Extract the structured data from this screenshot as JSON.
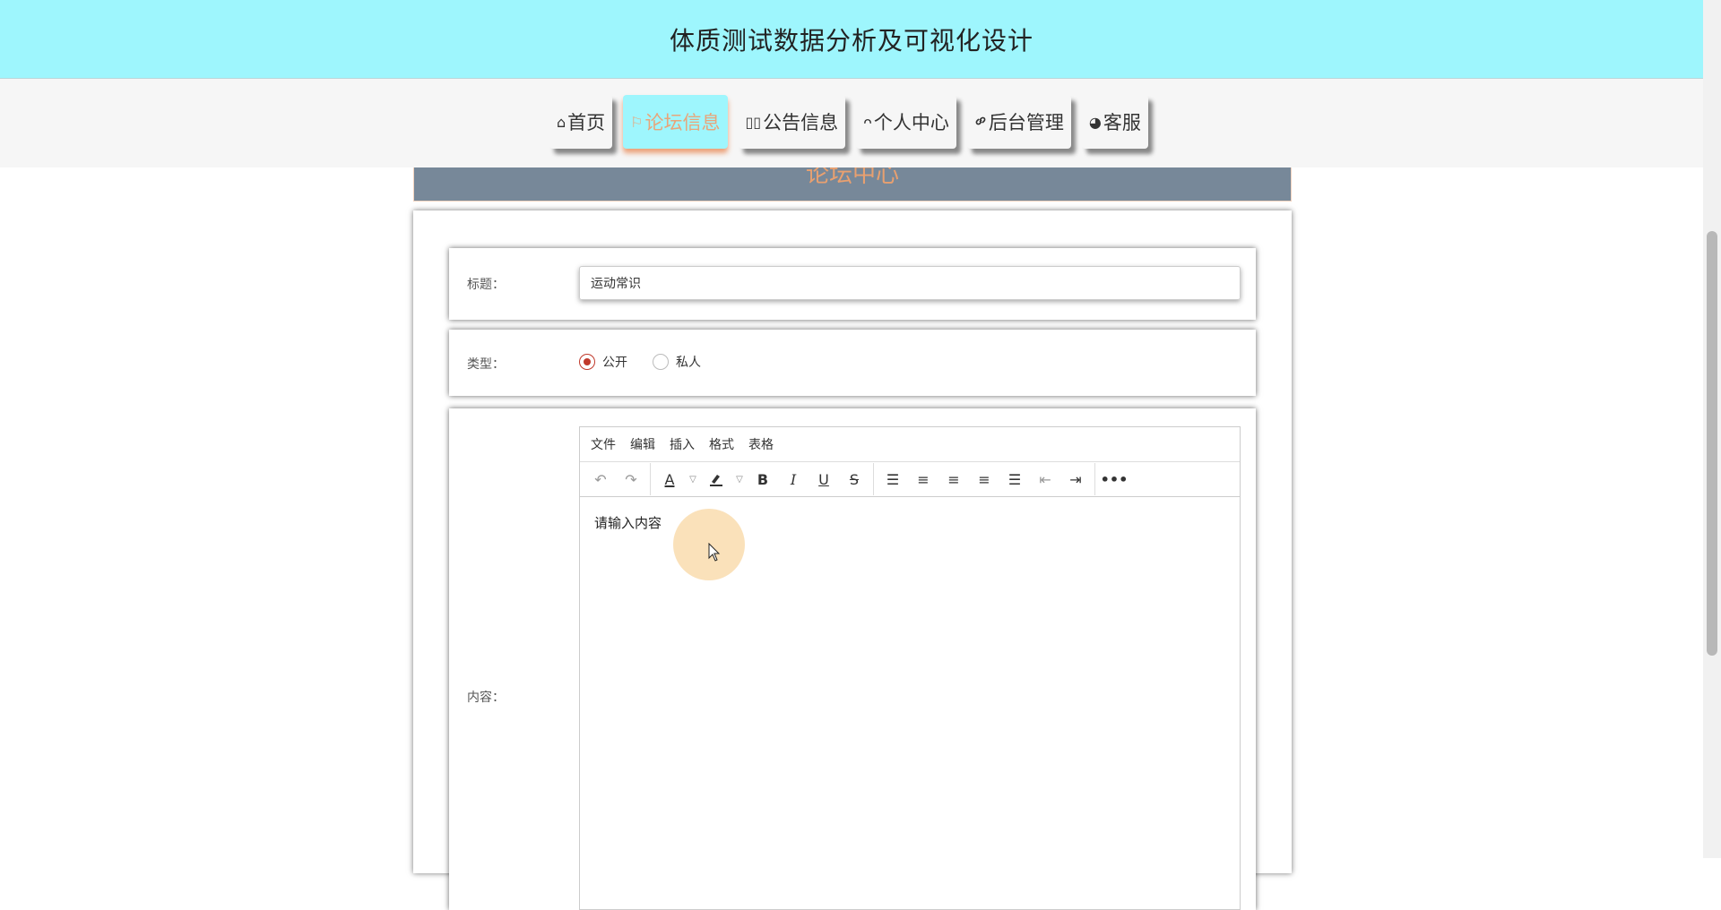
{
  "header": {
    "title": "体质测试数据分析及可视化设计"
  },
  "nav": {
    "items": [
      {
        "label": "首页",
        "icon": "home-icon",
        "glyph": "⌂"
      },
      {
        "label": "论坛信息",
        "icon": "flag-icon",
        "glyph": "⚐"
      },
      {
        "label": "公告信息",
        "icon": "book-icon",
        "glyph": "▯▯"
      },
      {
        "label": "个人中心",
        "icon": "user-icon",
        "glyph": "ᴖ"
      },
      {
        "label": "后台管理",
        "icon": "link-icon",
        "glyph": "🔗"
      },
      {
        "label": "客服",
        "icon": "chat-icon",
        "glyph": "◕"
      }
    ],
    "active_index": 1
  },
  "banner": {
    "title": "论坛中心"
  },
  "form": {
    "title_label": "标题：",
    "title_value": "运动常识",
    "type_label": "类型：",
    "type_options": [
      "公开",
      "私人"
    ],
    "type_selected": "公开",
    "content_label": "内容："
  },
  "editor": {
    "menu": [
      "文件",
      "编辑",
      "插入",
      "格式",
      "表格"
    ],
    "placeholder": "请输入内容",
    "toolbar_icons": [
      "undo-icon",
      "redo-icon",
      "font-color-icon",
      "highlight-icon",
      "bold-icon",
      "italic-icon",
      "underline-icon",
      "strikethrough-icon",
      "line-height-icon",
      "align-left-icon",
      "align-center-icon",
      "align-right-icon",
      "align-justify-icon",
      "outdent-icon",
      "indent-icon",
      "more-icon"
    ]
  },
  "colors": {
    "header_bg": "#9ef6fd",
    "nav_active_text": "#e8a57a",
    "banner_bg": "#778899",
    "radio_selected": "#c0392b"
  }
}
